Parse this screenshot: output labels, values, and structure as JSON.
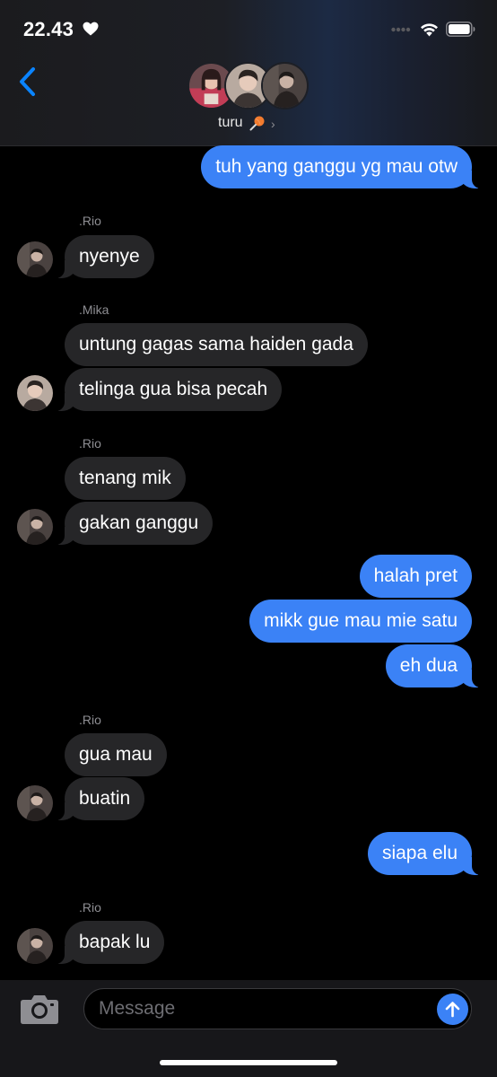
{
  "status_bar": {
    "time": "22.43",
    "icons": [
      "heart-icon",
      "signal-icon",
      "wifi-icon",
      "battery-icon"
    ]
  },
  "header": {
    "back_icon": "chevron-left-icon",
    "group_name": "turu",
    "group_emoji": "lollipop-emoji",
    "chevron": "›"
  },
  "messages": [
    {
      "direction": "out",
      "text": "tuh yang ganggu yg mau otw"
    },
    {
      "sender": ".Rio"
    },
    {
      "direction": "in",
      "text": "nyenye"
    },
    {
      "sender": ".Mika"
    },
    {
      "direction": "in",
      "text": "untung gagas sama haiden gada"
    },
    {
      "direction": "in",
      "text": "telinga gua bisa pecah"
    },
    {
      "sender": ".Rio"
    },
    {
      "direction": "in",
      "text": "tenang mik"
    },
    {
      "direction": "in",
      "text": "gakan ganggu"
    },
    {
      "direction": "out",
      "text": "halah pret"
    },
    {
      "direction": "out",
      "text": "mikk gue mau mie satu"
    },
    {
      "direction": "out",
      "text": "eh dua"
    },
    {
      "sender": ".Rio"
    },
    {
      "direction": "in",
      "text": "gua mau"
    },
    {
      "direction": "in",
      "text": "buatin"
    },
    {
      "direction": "out",
      "text": "siapa elu"
    },
    {
      "sender": ".Rio"
    },
    {
      "direction": "in",
      "text": "bapak lu"
    }
  ],
  "input_bar": {
    "camera_icon": "camera-icon",
    "placeholder": "Message",
    "send_icon": "arrow-up-icon"
  },
  "colors": {
    "outgoing_bubble": "#3b82f6",
    "incoming_bubble": "#262628",
    "accent": "#0a84ff",
    "sender_label": "#8e8e93"
  }
}
